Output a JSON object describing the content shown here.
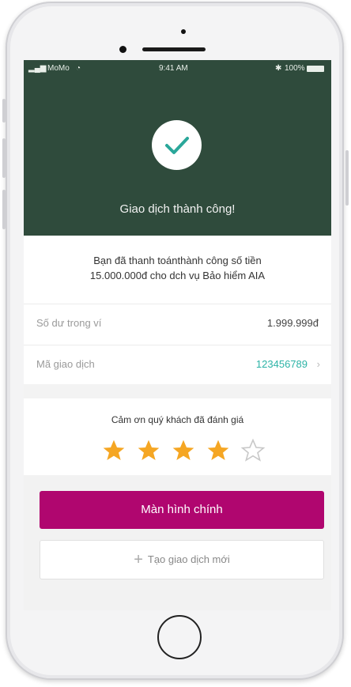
{
  "status_bar": {
    "carrier": "MoMo",
    "time": "9:41 AM",
    "battery": "100%"
  },
  "hero": {
    "title": "Giao dịch thành công!",
    "icon": "check-icon",
    "background": "#2f4b3c"
  },
  "message": {
    "line1": "Bạn đã thanh toánthành công số tiền",
    "line2": "15.000.000đ cho dch vụ Bảo hiểm AIA"
  },
  "details": {
    "balance_label": "Số dư trong ví",
    "balance_value": "1.999.999đ",
    "txn_label": "Mã giao dịch",
    "txn_value": "123456789"
  },
  "rating": {
    "title": "Cảm ơn quý khách đã đánh giá",
    "stars_filled": 4,
    "stars_total": 5,
    "star_color": "#f5a623"
  },
  "actions": {
    "primary_label": "Màn hình chính",
    "primary_color": "#b0066f",
    "secondary_label": "Tạo  giao dịch mới"
  }
}
